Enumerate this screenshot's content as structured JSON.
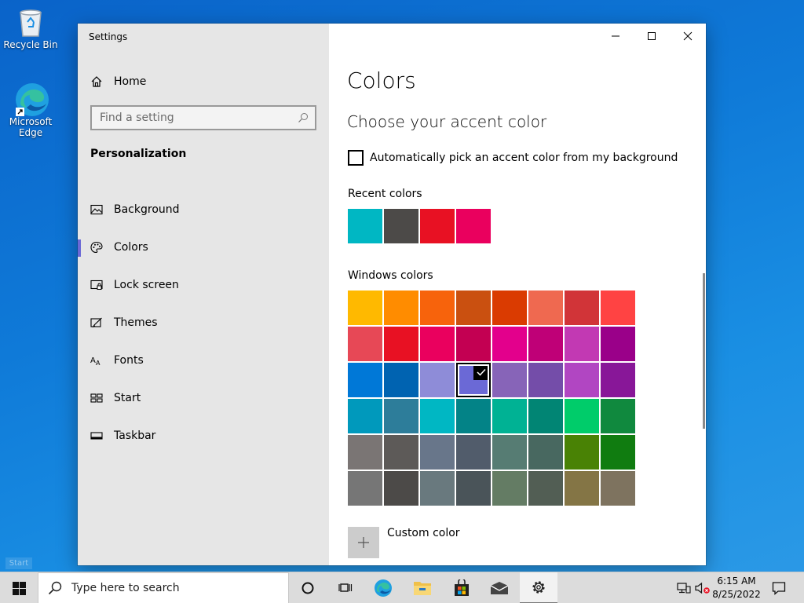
{
  "desktop": {
    "icons": [
      {
        "label": "Recycle Bin"
      },
      {
        "label_line1": "Microsoft",
        "label_line2": "Edge"
      }
    ],
    "start_ghost": "Start"
  },
  "window": {
    "title": "Settings",
    "controls": {
      "minimize": "minimize-icon",
      "maximize": "maximize-icon",
      "close": "close-icon"
    }
  },
  "sidebar": {
    "home_label": "Home",
    "search_placeholder": "Find a setting",
    "section": "Personalization",
    "items": [
      {
        "label": "Background",
        "icon": "image-icon"
      },
      {
        "label": "Colors",
        "icon": "palette-icon",
        "selected": true
      },
      {
        "label": "Lock screen",
        "icon": "lock-screen-icon"
      },
      {
        "label": "Themes",
        "icon": "themes-icon"
      },
      {
        "label": "Fonts",
        "icon": "fonts-icon"
      },
      {
        "label": "Start",
        "icon": "start-icon"
      },
      {
        "label": "Taskbar",
        "icon": "taskbar-icon"
      }
    ]
  },
  "main": {
    "title": "Colors",
    "subtitle": "Choose your accent color",
    "auto_pick_label": "Automatically pick an accent color from my background",
    "auto_pick_checked": false,
    "recent_label": "Recent colors",
    "recent_colors": [
      "#00b7c3",
      "#4c4a48",
      "#e81123",
      "#ea005e"
    ],
    "windows_label": "Windows colors",
    "windows_colors": [
      "#ffb900",
      "#ff8c00",
      "#f7630c",
      "#ca5010",
      "#da3b01",
      "#ef6950",
      "#d13438",
      "#ff4343",
      "#e74856",
      "#e81123",
      "#ea005e",
      "#c30052",
      "#e3008c",
      "#bf0077",
      "#c239b3",
      "#9a0089",
      "#0078d7",
      "#0063b1",
      "#8e8cd8",
      "#6b69d6",
      "#8764b8",
      "#744da9",
      "#b146c2",
      "#881798",
      "#0099bc",
      "#2d7d9a",
      "#00b7c3",
      "#038387",
      "#00b294",
      "#018574",
      "#00cc6a",
      "#10893e",
      "#7a7574",
      "#5d5a58",
      "#68768a",
      "#515c6b",
      "#567c73",
      "#486860",
      "#498205",
      "#107c10",
      "#767676",
      "#4c4a48",
      "#69797e",
      "#4a5459",
      "#647c64",
      "#525e54",
      "#847545",
      "#7e735f"
    ],
    "selected_color": "#6b69d6",
    "custom_color_label": "Custom color"
  },
  "taskbar": {
    "search_placeholder": "Type here to search",
    "time": "6:15 AM",
    "date": "8/25/2022"
  }
}
